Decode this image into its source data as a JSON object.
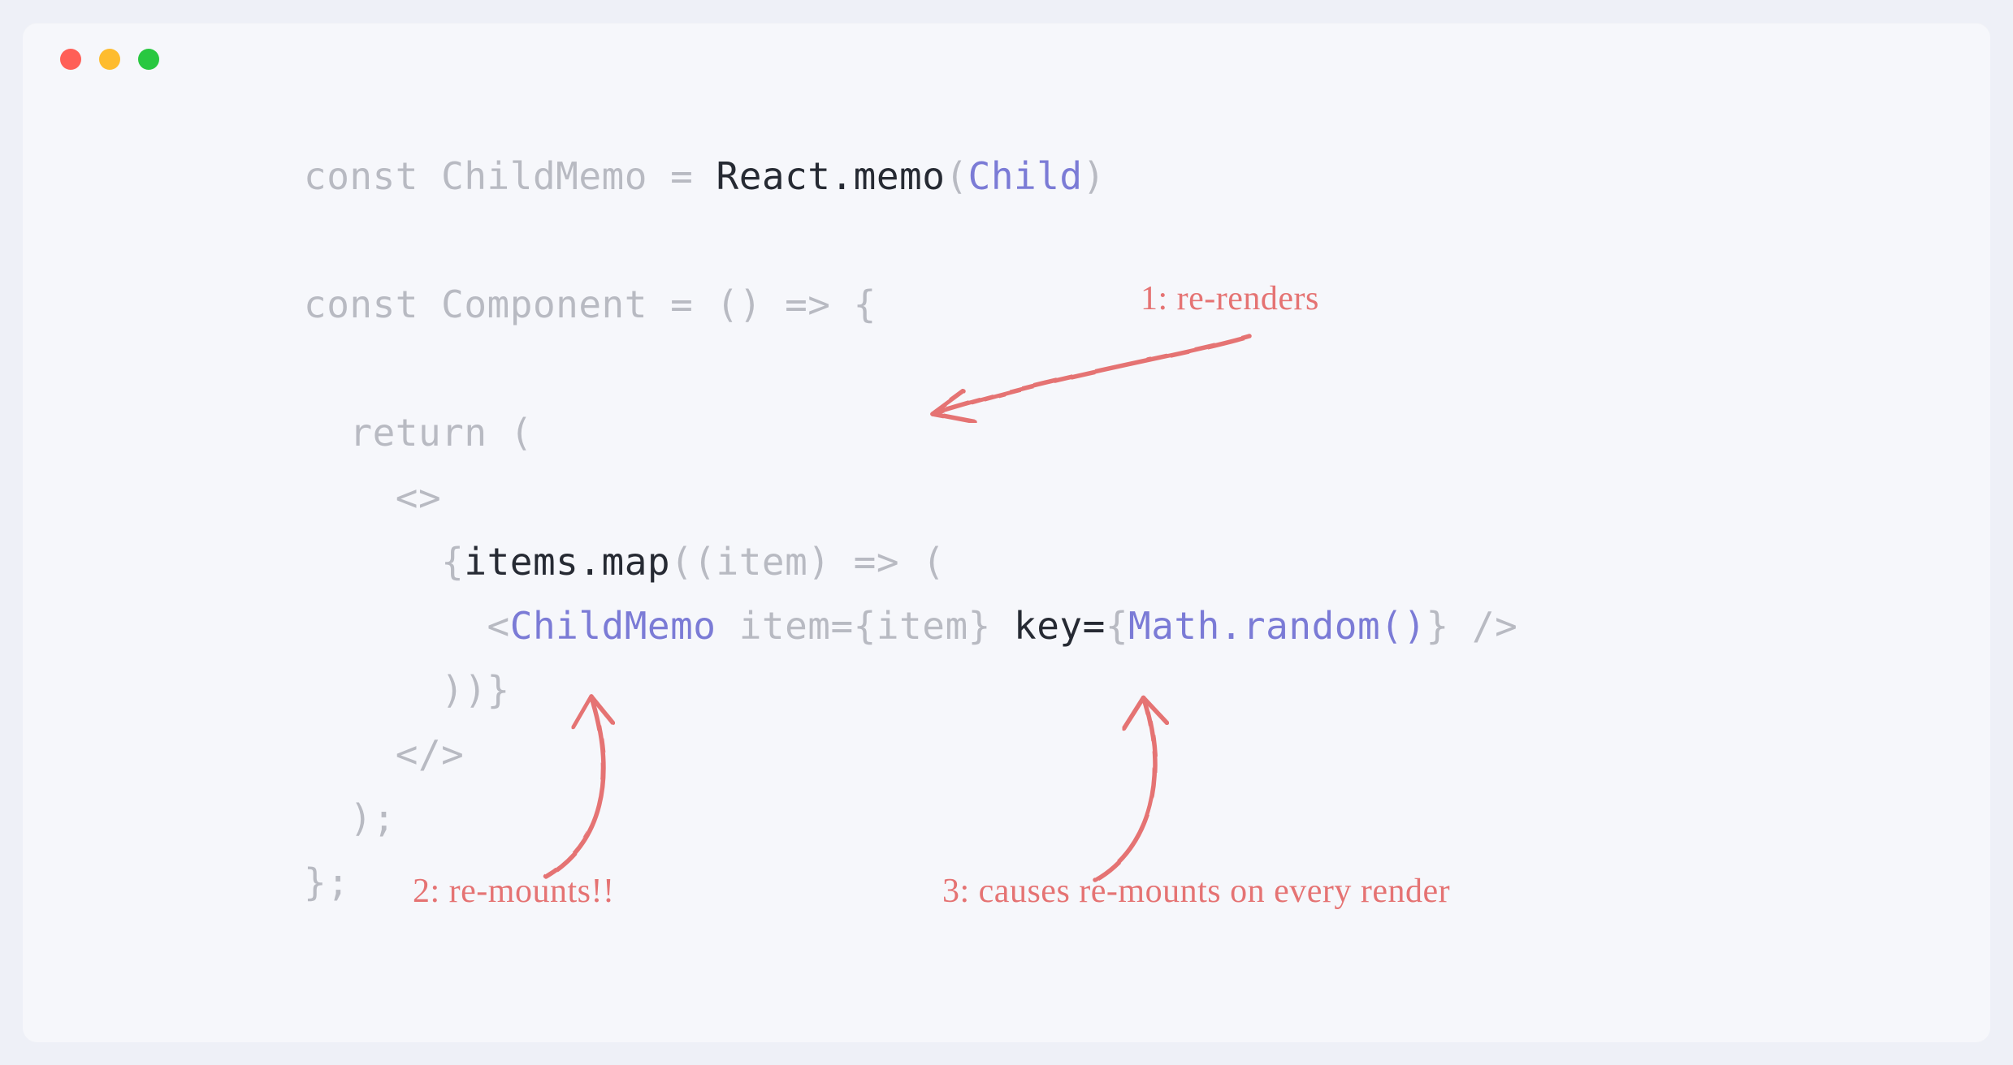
{
  "code": {
    "line1": {
      "a": "const ChildMemo = ",
      "b": "React.memo",
      "c": "(",
      "d": "Child",
      "e": ")"
    },
    "line3": "const Component = () => {",
    "line5": "  return (",
    "line6": "    <>",
    "line7": {
      "a": "      {",
      "b": "items.map",
      "c": "((item) => ("
    },
    "line8": {
      "a": "        <",
      "b": "ChildMemo",
      "c": " item={item} ",
      "d": "key=",
      "e": "{",
      "f": "Math.random()",
      "g": "}",
      "h": " />"
    },
    "line9": "      ))}",
    "line10": "    </>",
    "line11": "  );",
    "line12": "};"
  },
  "annotations": {
    "a1": "1: re-renders",
    "a2": "2: re-mounts!!",
    "a3": "3: causes re-mounts on every render"
  },
  "colors": {
    "background": "#eef0f7",
    "window": "#f6f7fb",
    "dim": "#b8bac2",
    "dark": "#262a33",
    "purple": "#7b7bd6",
    "annotation": "#e57373",
    "traffic_red": "#ff5f57",
    "traffic_yellow": "#febc2e",
    "traffic_green": "#28c840"
  }
}
